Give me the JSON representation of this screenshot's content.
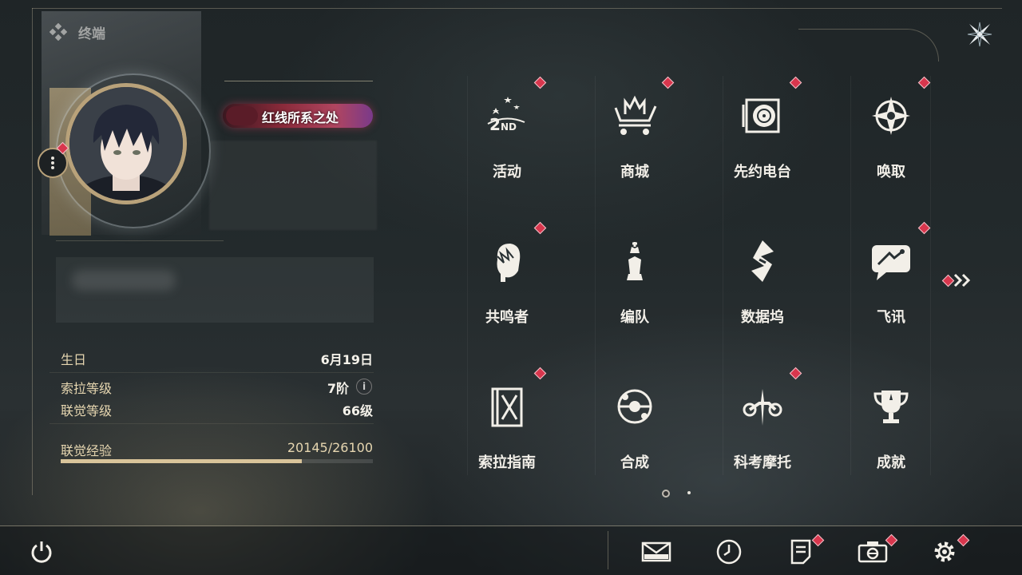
{
  "header": {
    "title": "终端"
  },
  "profile": {
    "title_badge": "红线所系之处",
    "stats": [
      {
        "label": "生日",
        "value": "6月19日"
      },
      {
        "label": "索拉等级",
        "value": "7阶"
      },
      {
        "label": "联觉等级",
        "value": "66级"
      }
    ],
    "exp": {
      "label": "联觉经验",
      "value": "20145/26100",
      "current": 20145,
      "max": 26100,
      "fraction": 0.772
    }
  },
  "menu": {
    "items": [
      {
        "label": "活动",
        "icon": "events-2nd-anniversary-icon",
        "badge": true
      },
      {
        "label": "商城",
        "icon": "shop-cart-icon",
        "badge": true
      },
      {
        "label": "先约电台",
        "icon": "radio-record-icon",
        "badge": true
      },
      {
        "label": "唤取",
        "icon": "convene-star-icon",
        "badge": true
      },
      {
        "label": "共鸣者",
        "icon": "resonator-head-icon",
        "badge": true
      },
      {
        "label": "编队",
        "icon": "team-chess-icon",
        "badge": false
      },
      {
        "label": "数据坞",
        "icon": "data-bank-icon",
        "badge": false
      },
      {
        "label": "飞讯",
        "icon": "chat-message-icon",
        "badge": true
      },
      {
        "label": "索拉指南",
        "icon": "guidebook-icon",
        "badge": true
      },
      {
        "label": "合成",
        "icon": "synthesis-icon",
        "badge": false
      },
      {
        "label": "科考摩托",
        "icon": "motorbike-icon",
        "badge": true
      },
      {
        "label": "成就",
        "icon": "achievement-trophy-icon",
        "badge": false
      }
    ],
    "page_count": 2,
    "active_page": 1
  },
  "bottom_bar": [
    {
      "name": "mail",
      "icon": "mail-icon",
      "badge": false
    },
    {
      "name": "clock",
      "icon": "clock-icon",
      "badge": false
    },
    {
      "name": "notice",
      "icon": "notice-icon",
      "badge": true
    },
    {
      "name": "camera",
      "icon": "camera-icon",
      "badge": true
    },
    {
      "name": "settings",
      "icon": "gear-icon",
      "badge": true
    }
  ],
  "colors": {
    "accent_gold": "#d9c49a",
    "badge_red": "#d8364d",
    "text": "#f2efe8"
  }
}
